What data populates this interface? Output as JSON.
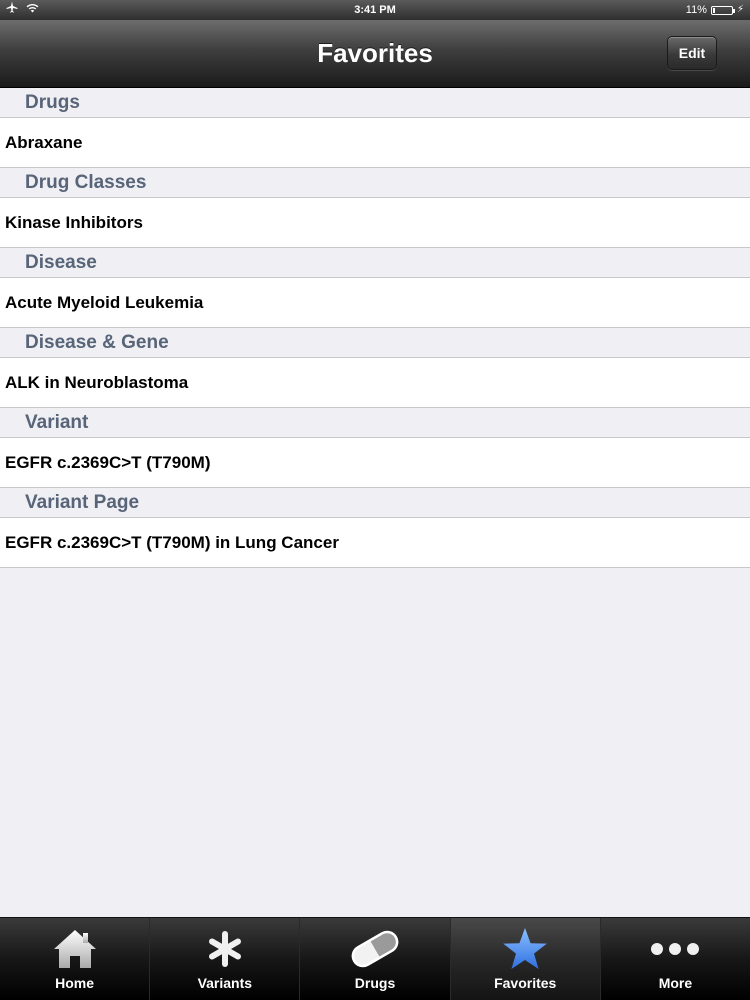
{
  "status_bar": {
    "time": "3:41 PM",
    "battery_percent_label": "11%",
    "battery_level": 0.11
  },
  "nav": {
    "title": "Favorites",
    "edit_label": "Edit"
  },
  "sections": [
    {
      "header": "Drugs",
      "items": [
        "Abraxane"
      ]
    },
    {
      "header": "Drug Classes",
      "items": [
        "Kinase Inhibitors"
      ]
    },
    {
      "header": "Disease",
      "items": [
        "Acute Myeloid Leukemia"
      ]
    },
    {
      "header": "Disease & Gene",
      "items": [
        "ALK in Neuroblastoma"
      ]
    },
    {
      "header": "Variant",
      "items": [
        "EGFR c.2369C>T (T790M)"
      ]
    },
    {
      "header": "Variant Page",
      "items": [
        "EGFR c.2369C>T (T790M) in Lung Cancer"
      ]
    }
  ],
  "tabs": [
    {
      "label": "Home",
      "icon": "home-icon"
    },
    {
      "label": "Variants",
      "icon": "asterisk-icon"
    },
    {
      "label": "Drugs",
      "icon": "pill-icon"
    },
    {
      "label": "Favorites",
      "icon": "star-icon",
      "selected": true
    },
    {
      "label": "More",
      "icon": "more-icon"
    }
  ],
  "colors": {
    "section_header_text": "#586478",
    "selected_tab_icon": "#4a86e8",
    "background": "#efeff4"
  }
}
